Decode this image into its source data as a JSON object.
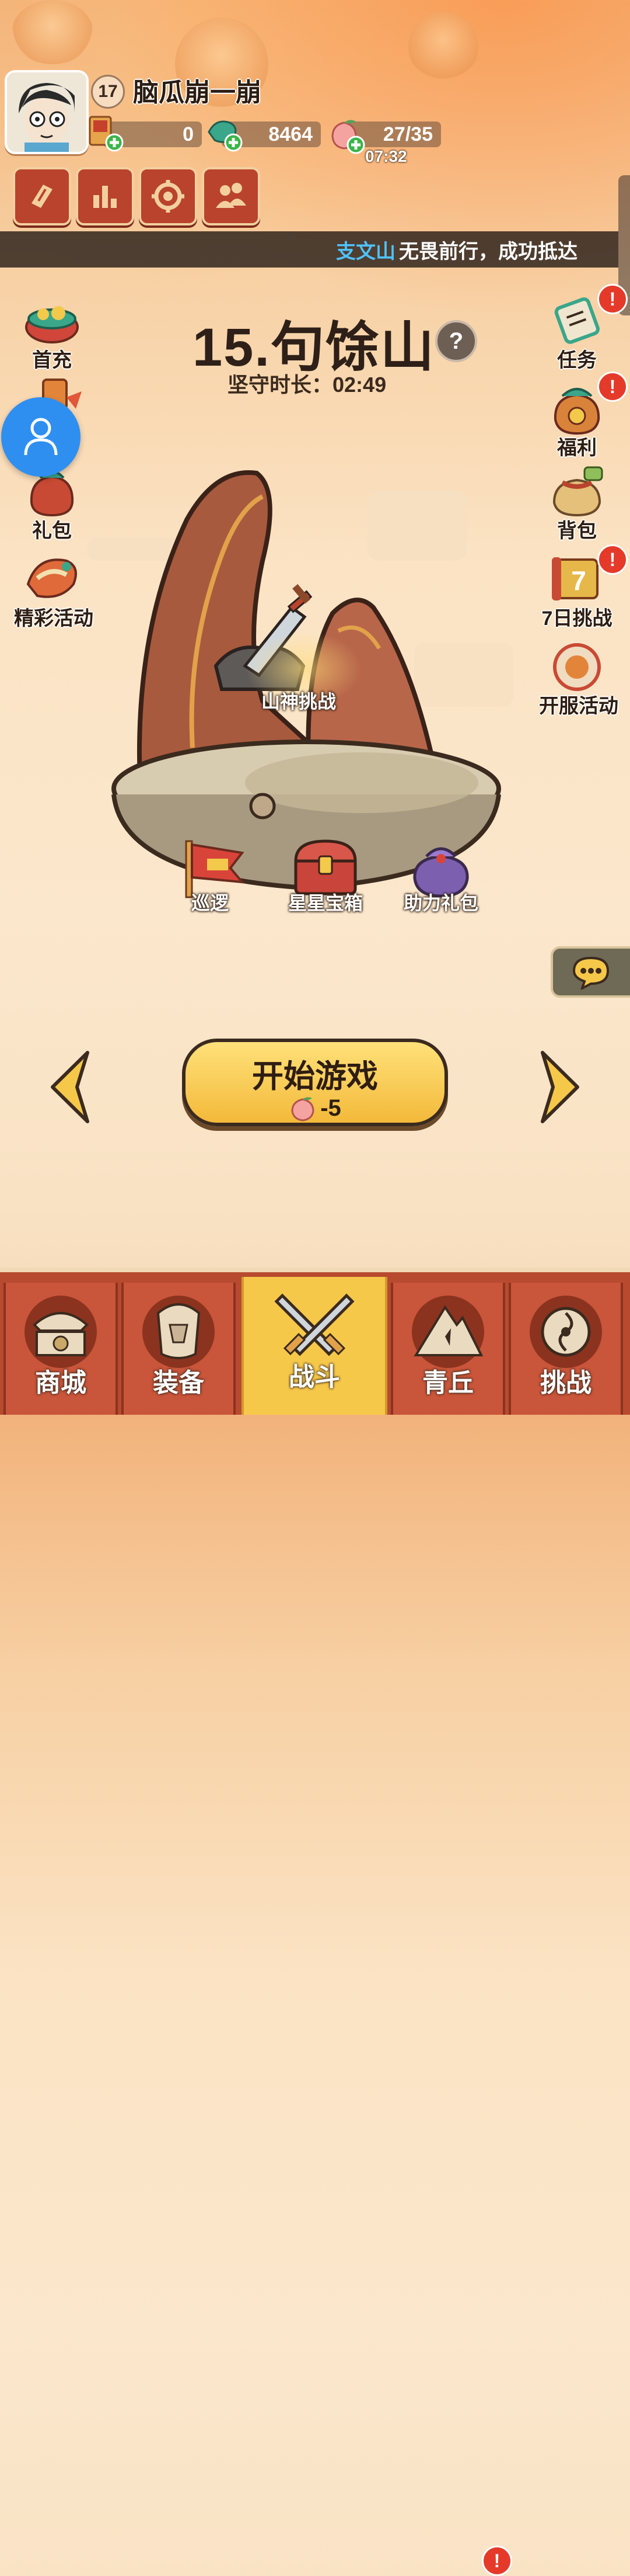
{
  "player": {
    "level": "17",
    "name": "脑瓜崩一崩"
  },
  "resources": {
    "coins": "0",
    "jade": "8464",
    "stamina": "27/35",
    "stamina_timer": "07:32"
  },
  "marquee": {
    "highlight": "支文山",
    "text": "无畏前行，成功抵达"
  },
  "stage": {
    "title": "15.句馀山",
    "help": "?",
    "timer_label": "坚守时长：",
    "timer_value": "02:49"
  },
  "left_menu": [
    "首充",
    "礼包",
    "精彩活动"
  ],
  "right_menu": [
    "任务",
    "福利",
    "背包",
    "7日挑战",
    "开服活动"
  ],
  "badge_mark": "!",
  "scene": {
    "challenge": "山神挑战",
    "patrol": "巡逻",
    "star_chest": "星星宝箱",
    "assist_gift": "助力礼包"
  },
  "start": {
    "label": "开始游戏",
    "cost": "-5"
  },
  "bottom_nav": [
    {
      "label": "商城",
      "icon": "shop-icon"
    },
    {
      "label": "装备",
      "icon": "armor-icon"
    },
    {
      "label": "战斗",
      "icon": "crossed-swords-icon"
    },
    {
      "label": "青丘",
      "icon": "mountain-icon"
    },
    {
      "label": "挑战",
      "icon": "challenge-icon"
    }
  ],
  "colors": {
    "accent_red": "#b9432c",
    "gold": "#f6c84a",
    "marquee_highlight": "#4fc2ff",
    "badge_red": "#e53a2a"
  }
}
